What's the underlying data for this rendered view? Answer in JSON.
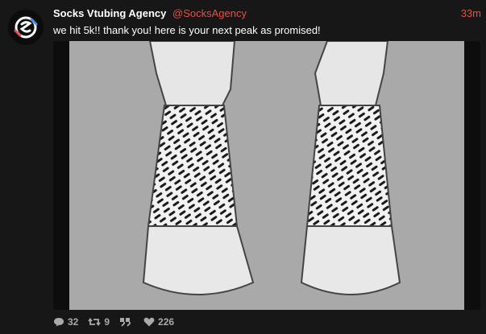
{
  "tweet": {
    "display_name": "Socks Vtubing Agency",
    "handle": "@SocksAgency",
    "time": "33m",
    "text": "we hit 5k!! thank you! here is your next peak as promised!",
    "media_alt_icon": "sock-feet-illustration"
  },
  "actions": {
    "replies": "32",
    "retweets": "9",
    "quote_icon": "quote-icon",
    "likes": "226"
  },
  "colors": {
    "accent": "#e0524b",
    "background": "#171717",
    "image_bg": "#a9a9a9"
  }
}
